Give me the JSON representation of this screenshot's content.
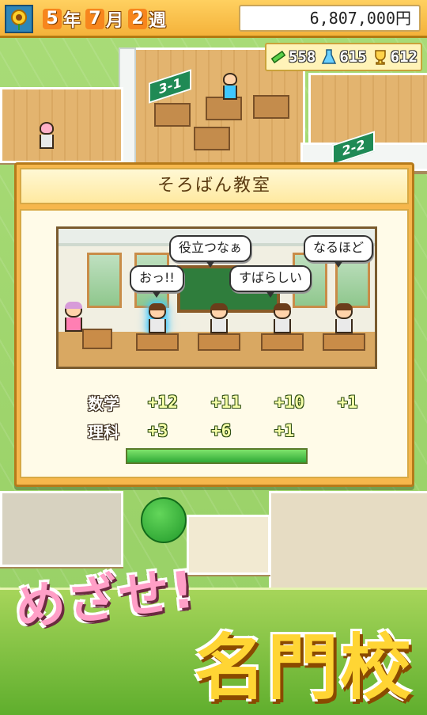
{
  "hud": {
    "year": "5",
    "year_unit": "年",
    "month": "7",
    "month_unit": "月",
    "week": "2",
    "week_unit": "週",
    "money": "6,807,000円",
    "stats": [
      {
        "icon": "pencil-icon",
        "value": "558"
      },
      {
        "icon": "flask-icon",
        "value": "615"
      },
      {
        "icon": "trophy-icon",
        "value": "612"
      }
    ]
  },
  "map": {
    "classroom_signs": [
      "3-1",
      "2-2"
    ]
  },
  "dialog": {
    "title": "そろばん教室",
    "bubbles": [
      "役立つなぁ",
      "なるほど",
      "おっ!!",
      "すばらしい"
    ],
    "results": [
      {
        "label": "数学",
        "values": [
          "+12",
          "+11",
          "+10",
          "+1"
        ]
      },
      {
        "label": "理科",
        "values": [
          "+3",
          "+6",
          "+1"
        ]
      }
    ],
    "progress": 1.0
  },
  "banner": {
    "line1": "めざせ!",
    "line2": "名門校"
  },
  "colors": {
    "hud_bg": "#f4b23a",
    "dialog_frame": "#f6b74c",
    "progress_fill": "#2fa836",
    "catch_pink": "#ff9fc7",
    "catch_yellow": "#ffd534"
  }
}
